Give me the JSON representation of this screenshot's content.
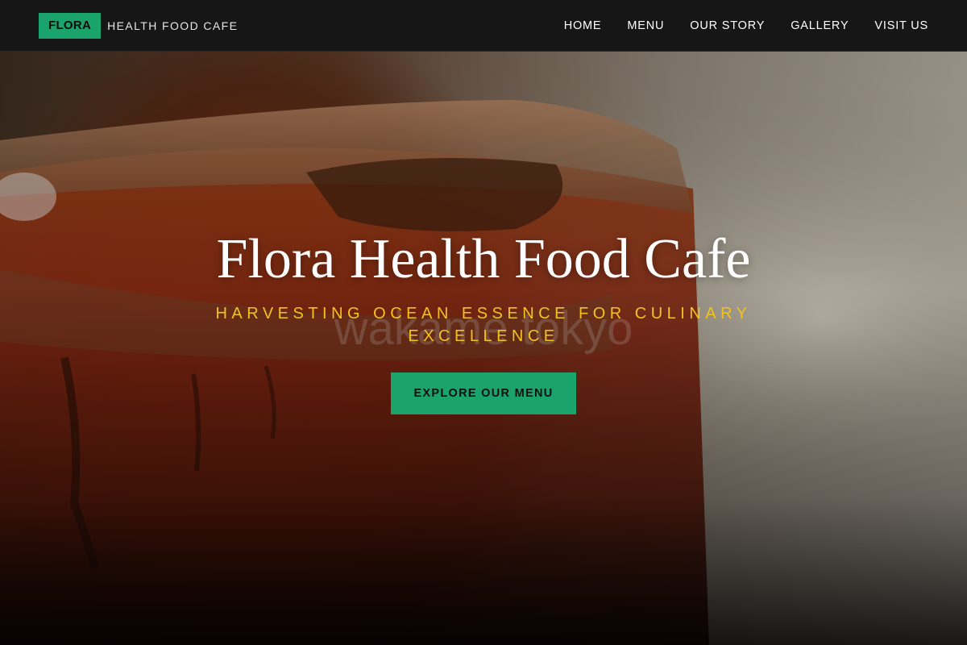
{
  "nav": {
    "brand_badge": "FLORA",
    "brand_sub": "HEALTH FOOD CAFE",
    "links": [
      "HOME",
      "MENU",
      "OUR STORY",
      "GALLERY",
      "VISIT US"
    ]
  },
  "hero": {
    "title": "Flora Health Food Cafe",
    "tagline": "HARVESTING OCEAN ESSENCE FOR CULINARY EXCELLENCE",
    "watermark": "wakame tokyo",
    "cta_label": "EXPLORE OUR MENU"
  },
  "colors": {
    "accent_green": "#1aa36a",
    "tagline_gold": "#f2c21d",
    "nav_bg": "#161616"
  }
}
